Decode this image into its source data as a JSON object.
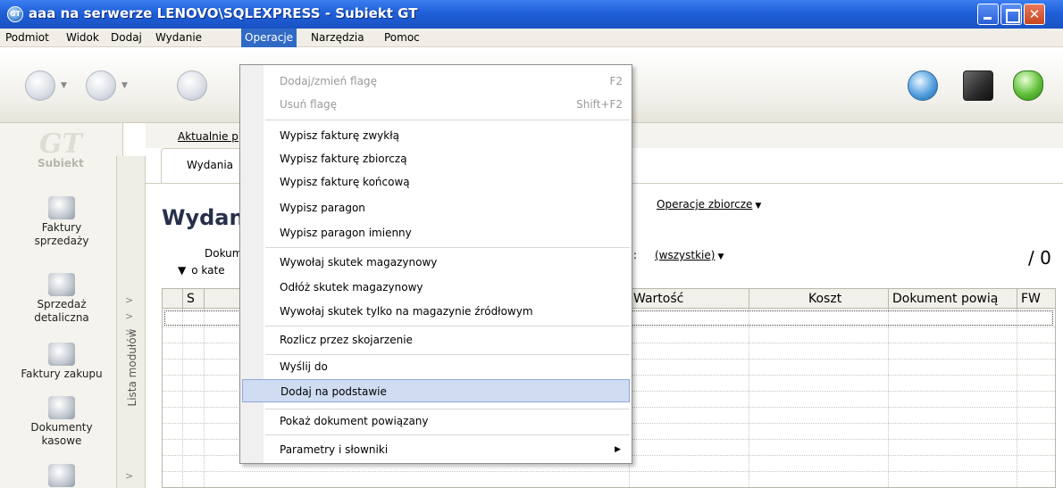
{
  "window": {
    "title": "aaa na serwerze LENOVO\\SQLEXPRESS - Subiekt GT",
    "app_icon_text": "GT"
  },
  "menubar": {
    "items": [
      "Podmiot",
      "Widok",
      "Dodaj",
      "Wydanie",
      "Operacje",
      "Narzędzia",
      "Pomoc"
    ],
    "active": "Operacje"
  },
  "sidebar": {
    "logo": "Subiekt",
    "logo_mark": "GT",
    "modules": [
      {
        "label_1": "Faktury",
        "label_2": "sprzedaży"
      },
      {
        "label_1": "Sprzedaż",
        "label_2": "detaliczna"
      },
      {
        "label_1": "Faktury zakupu",
        "label_2": ""
      },
      {
        "label_1": "Dokumenty",
        "label_2": "kasowe"
      }
    ],
    "strip_label": "Lista modułów",
    "strip_arrow": ">"
  },
  "tabs": {
    "link": "Aktualnie p",
    "subtab": "Wydania"
  },
  "main": {
    "page_title": "Wydan",
    "bulk_ops": "Operacje zbiorcze",
    "filter_line1": "Dokum",
    "filter_line2": "o kate",
    "filter_colon": ":",
    "filter_all": "(wszystkie)",
    "count": "/ 0",
    "caret": "▼",
    "tri": "▼"
  },
  "grid": {
    "columns": [
      "",
      "S",
      "",
      "Wartość",
      "Koszt",
      "Dokument powią",
      "FW"
    ]
  },
  "dropdown": {
    "items": [
      {
        "label": "Dodaj/zmień flagę",
        "shortcut": "F2",
        "disabled": true
      },
      {
        "label": "Usuń flagę",
        "shortcut": "Shift+F2",
        "disabled": true
      },
      {
        "label": "Wypisz fakturę zwykłą"
      },
      {
        "label": "Wypisz fakturę zbiorczą"
      },
      {
        "label": "Wypisz fakturę końcową"
      },
      {
        "label": "Wypisz paragon"
      },
      {
        "label": "Wypisz paragon imienny"
      },
      {
        "label": "Wywołaj skutek magazynowy"
      },
      {
        "label": "Odłóż skutek magazynowy"
      },
      {
        "label": "Wywołaj skutek tylko na magazynie źródłowym"
      },
      {
        "label": "Rozlicz przez skojarzenie"
      },
      {
        "label": "Wyślij do"
      },
      {
        "label": "Dodaj na podstawie",
        "hover": true
      },
      {
        "label": "Pokaż dokument powiązany"
      },
      {
        "label": "Parametry i słowniki",
        "submenu": true
      }
    ],
    "submenu_arrow": "▶"
  },
  "colors": {
    "titlebar": "#1f5fd8",
    "menu_active": "#316ac5",
    "hover_item": "#cfdcf2"
  }
}
